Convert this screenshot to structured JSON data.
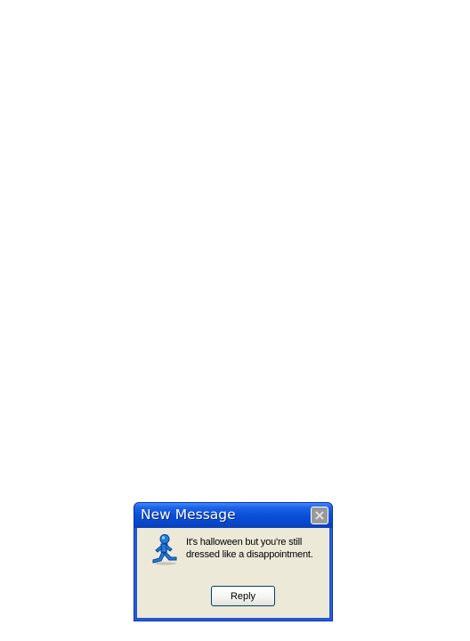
{
  "window": {
    "title": "New Message",
    "message": "It's halloween but you're still dressed like a disappointment.",
    "reply_label": "Reply",
    "icons": {
      "app": "aim-running-man-icon",
      "close": "close-icon"
    }
  },
  "colors": {
    "titlebar": "#0a4fd8",
    "client": "#ece9d8",
    "close_button": "#9a9a9a",
    "aim_blue": "#1e7fe0"
  }
}
